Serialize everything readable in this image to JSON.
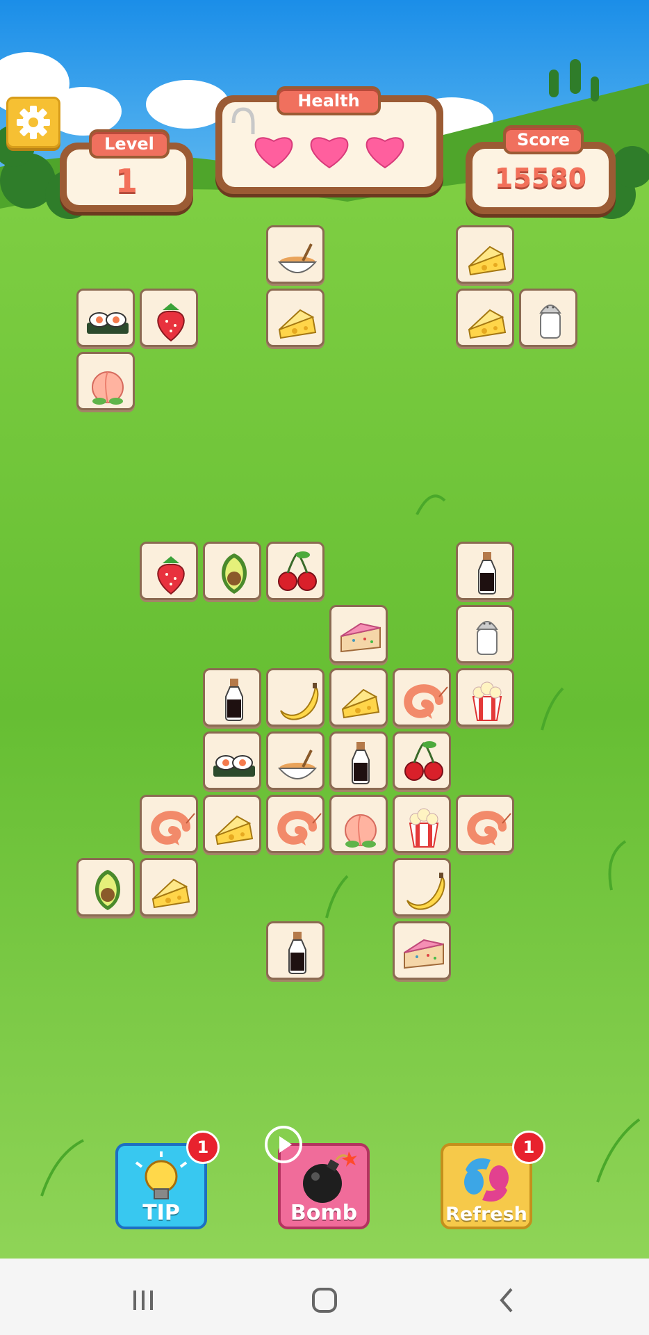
{
  "hud": {
    "level_label": "Level",
    "level_value": "1",
    "health_label": "Health",
    "health_hearts": 3,
    "score_label": "Score",
    "score_value": "15580"
  },
  "boosters": {
    "tip_label": "TIP",
    "tip_count": "1",
    "bomb_label": "Bomb",
    "refresh_label": "Refresh",
    "refresh_count": "1"
  },
  "board": {
    "rows": [
      [
        null,
        null,
        null,
        "soup",
        null,
        null,
        null,
        "cheese",
        null
      ],
      [
        null,
        "sushi",
        "strawberry",
        null,
        "cheese",
        null,
        null,
        null,
        "cheese",
        "salt"
      ],
      [
        null,
        "peach"
      ]
    ],
    "tiles": [
      {
        "item": "soup",
        "col": 4,
        "row": 0
      },
      {
        "item": "cheese",
        "col": 7,
        "row": 0
      },
      {
        "item": "sushi",
        "col": 1,
        "row": 1
      },
      {
        "item": "strawberry",
        "col": 2,
        "row": 1
      },
      {
        "item": "cheese",
        "col": 4,
        "row": 1
      },
      {
        "item": "cheese",
        "col": 7,
        "row": 1
      },
      {
        "item": "salt",
        "col": 8,
        "row": 1
      },
      {
        "item": "peach",
        "col": 1,
        "row": 2
      },
      {
        "item": "strawberry",
        "col": 2,
        "row": 5
      },
      {
        "item": "avocado",
        "col": 3,
        "row": 5
      },
      {
        "item": "cherry",
        "col": 4,
        "row": 5
      },
      {
        "item": "soy-sauce",
        "col": 7,
        "row": 5
      },
      {
        "item": "cake",
        "col": 5,
        "row": 6
      },
      {
        "item": "salt",
        "col": 7,
        "row": 6
      },
      {
        "item": "soy-sauce",
        "col": 3,
        "row": 7
      },
      {
        "item": "banana",
        "col": 4,
        "row": 7
      },
      {
        "item": "cheese",
        "col": 5,
        "row": 7
      },
      {
        "item": "shrimp",
        "col": 6,
        "row": 7
      },
      {
        "item": "popcorn",
        "col": 7,
        "row": 7
      },
      {
        "item": "sushi",
        "col": 3,
        "row": 8
      },
      {
        "item": "soup",
        "col": 4,
        "row": 8
      },
      {
        "item": "soy-sauce",
        "col": 5,
        "row": 8
      },
      {
        "item": "cherry",
        "col": 6,
        "row": 8
      },
      {
        "item": "shrimp",
        "col": 2,
        "row": 9
      },
      {
        "item": "cheese",
        "col": 3,
        "row": 9
      },
      {
        "item": "shrimp",
        "col": 4,
        "row": 9
      },
      {
        "item": "peach",
        "col": 5,
        "row": 9
      },
      {
        "item": "popcorn",
        "col": 6,
        "row": 9
      },
      {
        "item": "shrimp",
        "col": 7,
        "row": 9
      },
      {
        "item": "avocado",
        "col": 1,
        "row": 10
      },
      {
        "item": "cheese",
        "col": 2,
        "row": 10
      },
      {
        "item": "banana",
        "col": 6,
        "row": 10
      },
      {
        "item": "soy-sauce",
        "col": 4,
        "row": 11
      },
      {
        "item": "cake",
        "col": 6,
        "row": 11
      }
    ]
  },
  "icons": {
    "settings": "gear-icon",
    "tip": "lightbulb-icon",
    "bomb": "bomb-icon",
    "refresh": "shuffle-icon",
    "video": "play-video-icon"
  },
  "navbar": {
    "recent": "recent-apps-icon",
    "home": "home-icon",
    "back": "back-icon"
  },
  "colors": {
    "sky": "#1e90e8",
    "grass": "#6cc23a",
    "panel_frame": "#9b5b34",
    "tag_red": "#f0705e",
    "tip_blue": "#38c8f0",
    "bomb_pink": "#f06c9a",
    "refresh_yellow": "#f6c94a",
    "badge_red": "#e8222e"
  }
}
